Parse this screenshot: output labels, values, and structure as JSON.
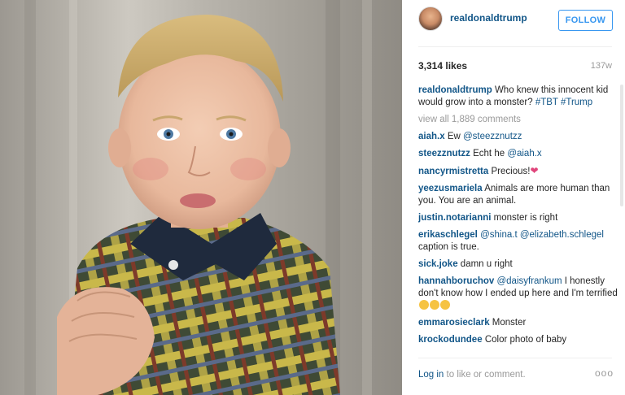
{
  "post": {
    "username": "realdonaldtrump",
    "follow_label": "FOLLOW",
    "likes": "3,314 likes",
    "time": "137w"
  },
  "caption": {
    "username": "realdonaldtrump",
    "text": "Who knew this innocent kid would grow into a monster?",
    "tags": "#TBT #Trump"
  },
  "view_all": "view all 1,889 comments",
  "comments": [
    {
      "user": "aiah.x",
      "pre": "Ew",
      "mention": "@steezznutzz",
      "post": ""
    },
    {
      "user": "steezznutzz",
      "pre": "Echt he",
      "mention": "@aiah.x",
      "post": ""
    },
    {
      "user": "nancyrmistretta",
      "pre": "Precious!",
      "mention": "",
      "post": ""
    },
    {
      "user": "yeezusmariela",
      "pre": "Animals are more human than you. You are an animal.",
      "mention": "",
      "post": ""
    },
    {
      "user": "justin.notarianni",
      "pre": "monster is right",
      "mention": "",
      "post": ""
    },
    {
      "user": "erikaschlegel",
      "pre": "",
      "mention": "@shina.t @elizabeth.schlegel",
      "post": "caption is true."
    },
    {
      "user": "sick.joke",
      "pre": "damn u right",
      "mention": "",
      "post": ""
    },
    {
      "user": "hannahboruchov",
      "pre": "",
      "mention": "@daisyfrankum",
      "post": "I honestly don't know how I ended up here and I'm terrified"
    },
    {
      "user": "emmarosieclark",
      "pre": "Monster",
      "mention": "",
      "post": ""
    },
    {
      "user": "krockodundee",
      "pre": "Color photo of baby",
      "mention": "",
      "post": ""
    }
  ],
  "footer": {
    "login": "Log in",
    "rest": "to like or comment.",
    "more": "ooo"
  },
  "colors": {
    "link": "#125688",
    "follow": "#3897f0",
    "muted": "#999999"
  }
}
